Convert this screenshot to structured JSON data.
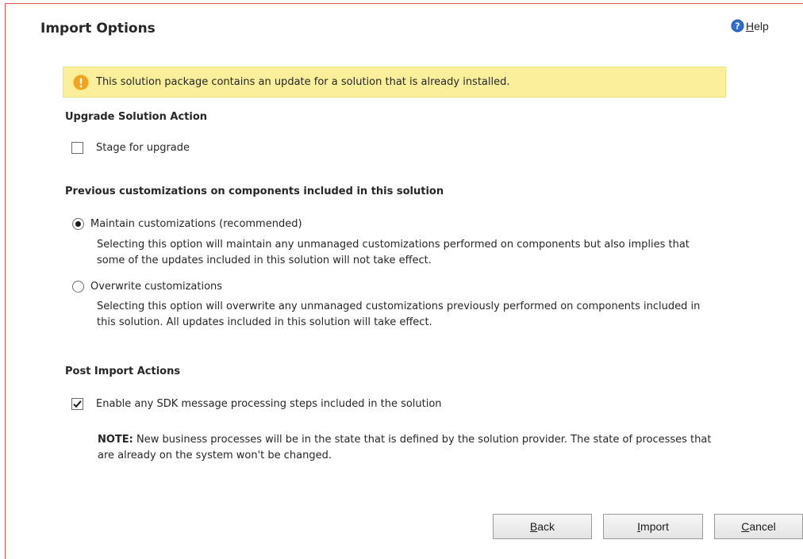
{
  "dialog": {
    "title": "Import Options",
    "help": {
      "first": "H",
      "rest": "elp"
    }
  },
  "notice": {
    "text": "This solution package contains an update for a solution that is already installed.",
    "color": "#fbef9b",
    "icon": "warning-icon"
  },
  "upgrade": {
    "heading": "Upgrade Solution Action",
    "stage_label": "Stage for upgrade",
    "stage_checked": false
  },
  "customizations": {
    "heading": "Previous customizations on components included in this solution",
    "options": [
      {
        "label": "Maintain customizations (recommended)",
        "selected": true,
        "description": "Selecting this option will maintain any unmanaged customizations performed on components but also implies that some of the updates included in this solution will not take effect."
      },
      {
        "label": "Overwrite customizations",
        "selected": false,
        "description": "Selecting this option will overwrite any unmanaged customizations previously performed on components included in this solution. All updates included in this solution will take effect."
      }
    ]
  },
  "post_import": {
    "heading": "Post Import Actions",
    "sdk_label": "Enable any SDK message processing steps included in the solution",
    "sdk_checked": true,
    "note_prefix": "NOTE:",
    "note_text": " New business processes will be in the state that is defined by the solution provider. The state of processes that are already on the system won't be changed."
  },
  "buttons": {
    "back": {
      "first": "B",
      "rest": "ack"
    },
    "import": {
      "first": "I",
      "rest": "mport"
    },
    "cancel": {
      "first": "C",
      "rest": "ancel"
    }
  }
}
